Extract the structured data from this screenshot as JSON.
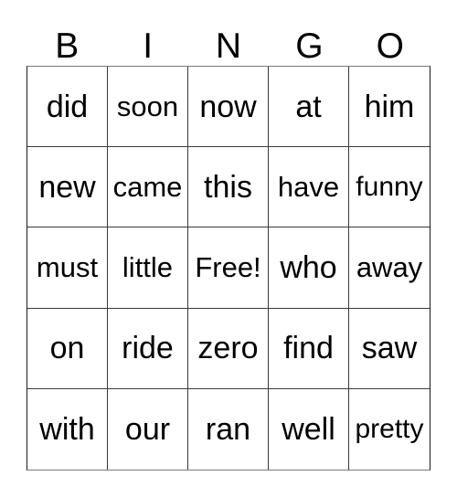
{
  "card": {
    "title": "BINGO",
    "headers": [
      "B",
      "I",
      "N",
      "G",
      "O"
    ],
    "free_space_label": "Free!",
    "colors": {
      "background": "#ffffff",
      "text": "#000000",
      "grid_line": "#3a3a3a",
      "outer_border": "#1a1a1a"
    },
    "rows": [
      {
        "cells": [
          "did",
          "soon",
          "now",
          "at",
          "him"
        ]
      },
      {
        "cells": [
          "new",
          "came",
          "this",
          "have",
          "funny"
        ]
      },
      {
        "cells": [
          "must",
          "little",
          "Free!",
          "who",
          "away"
        ]
      },
      {
        "cells": [
          "on",
          "ride",
          "zero",
          "find",
          "saw"
        ]
      },
      {
        "cells": [
          "with",
          "our",
          "ran",
          "well",
          "pretty"
        ]
      }
    ]
  }
}
